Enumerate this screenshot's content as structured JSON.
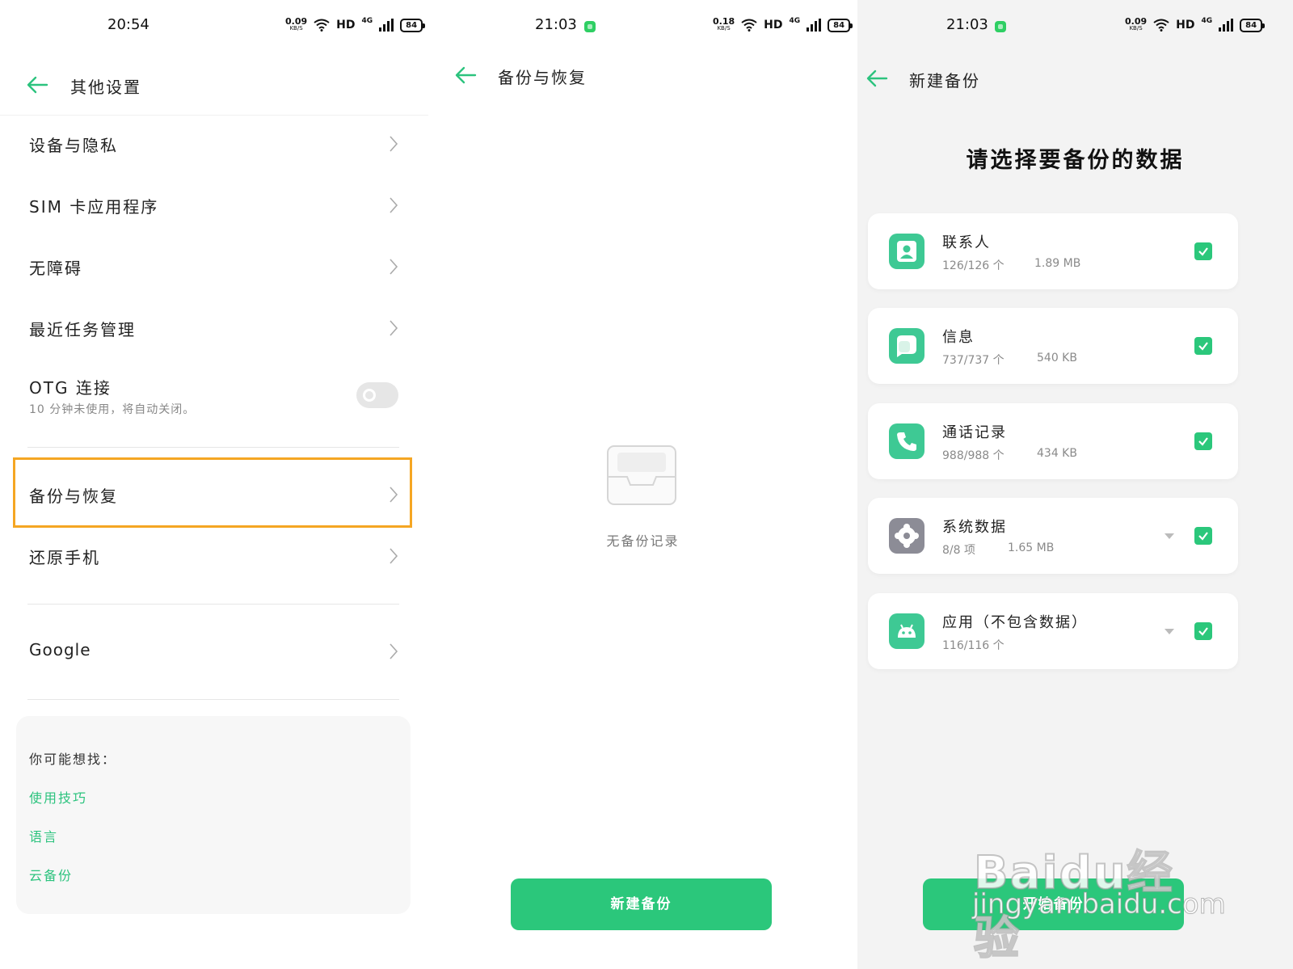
{
  "panel1": {
    "status": {
      "time": "20:54",
      "speed_value": "0.09",
      "speed_unit": "KB/S",
      "hd": "HD",
      "net": "4G",
      "battery": "84"
    },
    "header": {
      "title": "其他设置"
    },
    "items": [
      {
        "label": "设备与隐私"
      },
      {
        "label": "SIM 卡应用程序"
      },
      {
        "label": "无障碍"
      },
      {
        "label": "最近任务管理"
      },
      {
        "label": "OTG 连接",
        "sub": "10 分钟未使用，将自动关闭。",
        "toggle": "off"
      },
      {
        "label": "备份与恢复"
      },
      {
        "label": "还原手机"
      },
      {
        "label": "Google"
      }
    ],
    "suggest": {
      "heading": "你可能想找：",
      "links": [
        "使用技巧",
        "语言",
        "云备份"
      ]
    },
    "colors": {
      "accent": "#2cc37e",
      "highlight": "#f5a623"
    }
  },
  "panel2": {
    "status": {
      "time": "21:03",
      "speed_value": "0.18",
      "speed_unit": "KB/S",
      "hd": "HD",
      "net": "4G",
      "battery": "84"
    },
    "header": {
      "title": "备份与恢复"
    },
    "empty_text": "无备份记录",
    "button": "新建备份"
  },
  "panel3": {
    "status": {
      "time": "21:03",
      "speed_value": "0.09",
      "speed_unit": "KB/S",
      "hd": "HD",
      "net": "4G",
      "battery": "84"
    },
    "header": {
      "title": "新建备份"
    },
    "heading": "请选择要备份的数据",
    "items": [
      {
        "name": "联系人",
        "count": "126/126 个",
        "size": "1.89 MB",
        "icon": "contact-icon",
        "checked": true
      },
      {
        "name": "信息",
        "count": "737/737 个",
        "size": "540 KB",
        "icon": "message-icon",
        "checked": true
      },
      {
        "name": "通话记录",
        "count": "988/988 个",
        "size": "434 KB",
        "icon": "phone-icon",
        "checked": true
      },
      {
        "name": "系统数据",
        "count": "8/8 项",
        "size": "1.65 MB",
        "icon": "settings-icon",
        "checked": true,
        "expandable": true
      },
      {
        "name": "应用（不包含数据）",
        "count": "116/116 个",
        "size": "",
        "icon": "android-icon",
        "checked": true,
        "expandable": true
      }
    ],
    "button": "开始备份",
    "watermark": {
      "line1": "Baidu经验",
      "line2": "jingyan.baidu.com"
    }
  }
}
